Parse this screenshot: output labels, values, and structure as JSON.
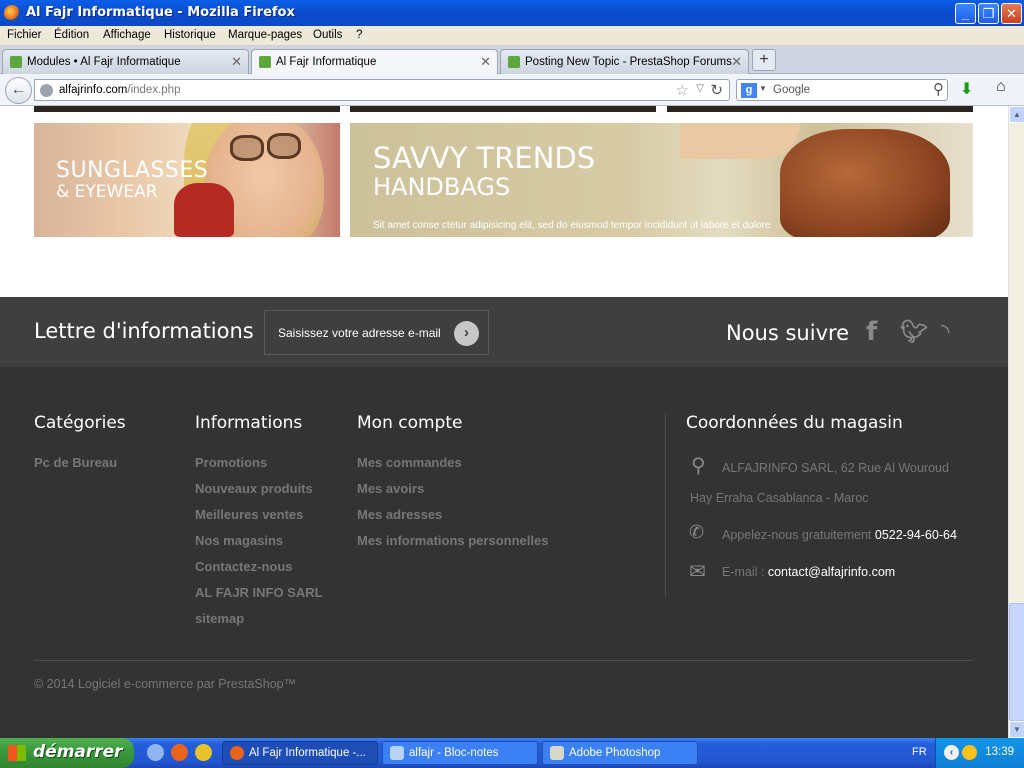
{
  "window": {
    "title": "Al Fajr Informatique - Mozilla Firefox"
  },
  "menu": {
    "items": [
      "Fichier",
      "Édition",
      "Affichage",
      "Historique",
      "Marque-pages",
      "Outils",
      "?"
    ]
  },
  "tabs": [
    {
      "label": "Modules • Al Fajr Informatique",
      "active": false
    },
    {
      "label": "Al Fajr Informatique",
      "active": true
    },
    {
      "label": "Posting New Topic - PrestaShop Forums",
      "active": false
    }
  ],
  "navbar": {
    "url_domain": "alfajrinfo.com",
    "url_path": "/index.php",
    "search_placeholder": "Google"
  },
  "banners": {
    "sunglasses": {
      "line1": "SUNGLASSES",
      "line2": "& EYEWEAR"
    },
    "handbags": {
      "line1": "SAVVY TRENDS",
      "line2": "HANDBAGS",
      "line3": "Sit amet conse ctetur adipisicing elit, sed do eiusmod tempor incididunt ut labore et dolore"
    }
  },
  "newsletter": {
    "title": "Lettre d'informations",
    "placeholder": "Saisissez votre adresse e-mail",
    "follow_title": "Nous suivre",
    "social": [
      "facebook-icon",
      "twitter-icon",
      "rss-icon"
    ]
  },
  "footer": {
    "categories": {
      "title": "Catégories",
      "items": [
        "Pc de Bureau"
      ]
    },
    "informations": {
      "title": "Informations",
      "items": [
        "Promotions",
        "Nouveaux produits",
        "Meilleures ventes",
        "Nos magasins",
        "Contactez-nous",
        "AL FAJR INFO SARL",
        "sitemap"
      ]
    },
    "account": {
      "title": "Mon compte",
      "items": [
        "Mes commandes",
        "Mes avoirs",
        "Mes adresses",
        "Mes informations personnelles"
      ]
    },
    "store": {
      "title": "Coordonnées du magasin",
      "address_line1": "ALFAJRINFO SARL, 62 Rue Al Wouroud",
      "address_line2": "Hay Erraha Casablanca - Maroc",
      "phone_label": "Appelez-nous gratuitement",
      "phone": "0522-94-60-64",
      "email_label": "E-mail :",
      "email": "contact@alfajrinfo.com"
    },
    "copyright": "© 2014 Logiciel e-commerce par PrestaShop™"
  },
  "taskbar": {
    "start_label": "démarrer",
    "tasks": [
      {
        "label": "Al Fajr Informatique -...",
        "active": true
      },
      {
        "label": "alfajr - Bloc-notes",
        "active": false
      },
      {
        "label": "Adobe Photoshop",
        "active": false
      }
    ],
    "language": "FR",
    "clock": "13:39"
  }
}
